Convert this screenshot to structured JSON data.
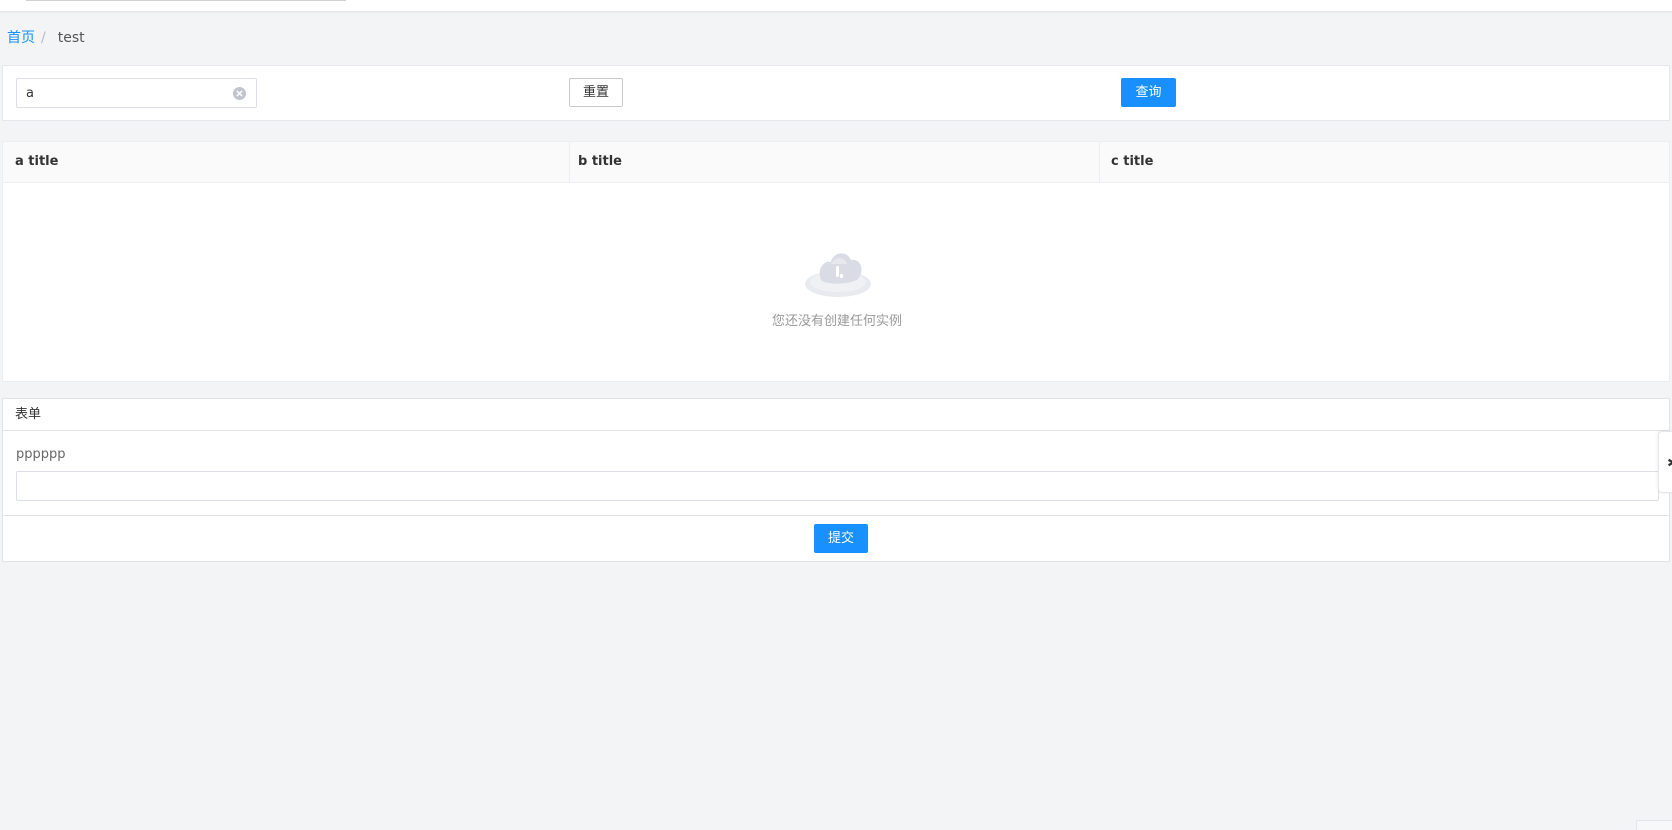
{
  "breadcrumb": {
    "home": "首页",
    "separator": "/",
    "current": "test"
  },
  "filter": {
    "search_value": "a",
    "reset_label": "重置",
    "query_label": "查询"
  },
  "table": {
    "columns": [
      "a title",
      "b title",
      "c title"
    ],
    "rows": [],
    "empty_text": "您还没有创建任何实例"
  },
  "form": {
    "title": "表单",
    "field_label": "pppppp",
    "field_value": "",
    "submit_label": "提交"
  },
  "side_handle": {
    "icon": "gear-icon"
  },
  "colors": {
    "primary": "#1890ff",
    "background": "#f3f4f6",
    "border": "#e6e7ea"
  }
}
